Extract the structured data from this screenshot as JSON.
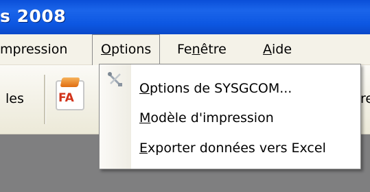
{
  "window": {
    "title": "s 2008"
  },
  "menubar": {
    "items": [
      {
        "id": "impression",
        "label": "mpression"
      },
      {
        "id": "options",
        "label": "Options",
        "underline": "O"
      },
      {
        "id": "fenetre",
        "label": "Fenêtre",
        "underline": "n"
      },
      {
        "id": "aide",
        "label": "Aide",
        "underline": "A"
      }
    ]
  },
  "toolbar": {
    "left_label": "les",
    "fa_icon_text": "FA",
    "right_label": "re"
  },
  "options_menu": {
    "items": [
      {
        "label": "Options de SYSGCOM...",
        "icon": "tools-icon"
      },
      {
        "label": "Modèle d'impression"
      },
      {
        "label": "Exporter données vers Excel"
      }
    ]
  },
  "colors": {
    "titlebar": "#0d57e2",
    "menubar": "#f4f2e8",
    "workspace": "#7f7f80"
  }
}
